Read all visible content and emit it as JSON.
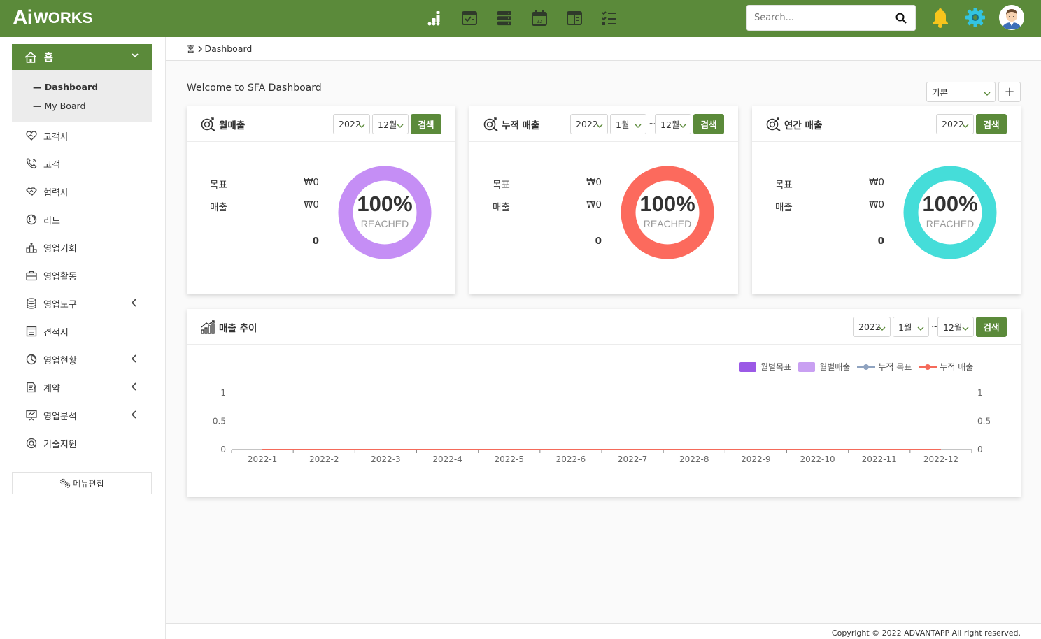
{
  "header": {
    "logo_ai": "Ai",
    "logo_works": "WORKS",
    "search_placeholder": "Search...",
    "icons": [
      "chart-bar-icon",
      "window-check-icon",
      "server-icon",
      "calendar-icon",
      "card-icon",
      "checklist-icon",
      "bell-icon",
      "gear-icon"
    ],
    "accent_color": "#5b8a3a"
  },
  "sidebar": {
    "home_label": "홈",
    "sub_items": [
      "Dashboard",
      "My Board"
    ],
    "items": [
      {
        "label": "고객사",
        "icon": "heart-handshake-icon",
        "expandable": false
      },
      {
        "label": "고객",
        "icon": "phone-icon",
        "expandable": false
      },
      {
        "label": "협력사",
        "icon": "handshake-icon",
        "expandable": false
      },
      {
        "label": "리드",
        "icon": "globe-icon",
        "expandable": false
      },
      {
        "label": "영업기회",
        "icon": "podium-icon",
        "expandable": false
      },
      {
        "label": "영업활동",
        "icon": "briefcase-icon",
        "expandable": false
      },
      {
        "label": "영업도구",
        "icon": "database-icon",
        "expandable": true
      },
      {
        "label": "견적서",
        "icon": "document-list-icon",
        "expandable": false
      },
      {
        "label": "영업현황",
        "icon": "pie-icon",
        "expandable": true
      },
      {
        "label": "계약",
        "icon": "contract-icon",
        "expandable": true
      },
      {
        "label": "영업분석",
        "icon": "presentation-icon",
        "expandable": true
      },
      {
        "label": "기술지원",
        "icon": "support-icon",
        "expandable": false
      }
    ],
    "menu_edit": "메뉴편집"
  },
  "breadcrumb": {
    "home": "홈",
    "current": "Dashboard"
  },
  "welcome": "Welcome to SFA Dashboard",
  "layout_select": "기본",
  "cards": [
    {
      "title": "월매출",
      "year": "2022",
      "month": "12월",
      "search": "검색",
      "target_label": "목표",
      "target_value": "₩0",
      "sales_label": "매출",
      "sales_value": "₩0",
      "total": "0",
      "percent": "100%",
      "reached": "REACHED",
      "color": "#c58ef5"
    },
    {
      "title": "누적 매출",
      "year": "2022",
      "month_from": "1월",
      "tilde": "~",
      "month_to": "12월",
      "search": "검색",
      "target_label": "목표",
      "target_value": "₩0",
      "sales_label": "매출",
      "sales_value": "₩0",
      "total": "0",
      "percent": "100%",
      "reached": "REACHED",
      "color": "#fc6a5d"
    },
    {
      "title": "연간 매출",
      "year": "2022",
      "search": "검색",
      "target_label": "목표",
      "target_value": "₩0",
      "sales_label": "매출",
      "sales_value": "₩0",
      "total": "0",
      "percent": "100%",
      "reached": "REACHED",
      "color": "#45ddd9"
    }
  ],
  "trend": {
    "title": "매출 추이",
    "year": "2022",
    "month_from": "1월",
    "tilde": "~",
    "month_to": "12월",
    "search": "검색"
  },
  "chart_data": {
    "type": "bar",
    "categories": [
      "2022-1",
      "2022-2",
      "2022-3",
      "2022-4",
      "2022-5",
      "2022-6",
      "2022-7",
      "2022-8",
      "2022-9",
      "2022-10",
      "2022-11",
      "2022-12"
    ],
    "series": [
      {
        "name": "월별목표",
        "type": "bar",
        "color": "#9b59e6",
        "values": [
          0,
          0,
          0,
          0,
          0,
          0,
          0,
          0,
          0,
          0,
          0,
          0
        ]
      },
      {
        "name": "월별매출",
        "type": "bar",
        "color": "#c9a0f2",
        "values": [
          0,
          0,
          0,
          0,
          0,
          0,
          0,
          0,
          0,
          0,
          0,
          0
        ]
      },
      {
        "name": "누적 목표",
        "type": "line",
        "color": "#8fa3c0",
        "values": [
          0,
          0,
          0,
          0,
          0,
          0,
          0,
          0,
          0,
          0,
          0,
          0
        ]
      },
      {
        "name": "누적 매출",
        "type": "line",
        "color": "#f56a5a",
        "values": [
          0,
          0,
          0,
          0,
          0,
          0,
          0,
          0,
          0,
          0,
          0,
          0
        ]
      }
    ],
    "ylim": [
      0,
      1
    ],
    "y_ticks": [
      "1",
      "0.5",
      "0"
    ],
    "y2_ticks": [
      "1",
      "0.5",
      "0"
    ],
    "legend": "top-right"
  },
  "footer": "Copyright © 2022 ADVANTAPP All right reserved."
}
